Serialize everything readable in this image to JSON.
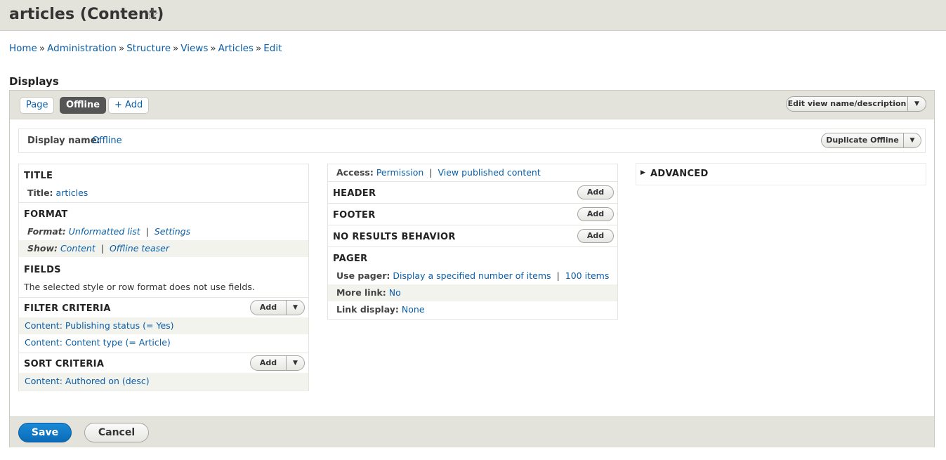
{
  "header": {
    "title": "articles (Content)",
    "star_icon": "☆"
  },
  "breadcrumb": {
    "items": [
      "Home",
      "Administration",
      "Structure",
      "Views",
      "Articles",
      "Edit"
    ],
    "separator": "»"
  },
  "displays": {
    "heading": "Displays",
    "tabs": [
      {
        "label": "Page"
      },
      {
        "label": "Offline"
      }
    ],
    "add_label": "+ Add",
    "edit_view_label": "Edit view name/description",
    "display_name_label": "Display name:",
    "display_name_value": "Offline",
    "duplicate_label": "Duplicate Offline"
  },
  "left": {
    "title_section": {
      "heading": "TITLE",
      "label": "Title:",
      "value": "articles"
    },
    "format_section": {
      "heading": "FORMAT",
      "format_label": "Format:",
      "format_value": "Unformatted list",
      "format_settings": "Settings",
      "show_label": "Show:",
      "show_value": "Content",
      "show_mode": "Offline teaser"
    },
    "fields_section": {
      "heading": "FIELDS",
      "note": "The selected style or row format does not use fields."
    },
    "filter_section": {
      "heading": "FILTER CRITERIA",
      "add_label": "Add",
      "items": [
        "Content: Publishing status (= Yes)",
        "Content: Content type (= Article)"
      ]
    },
    "sort_section": {
      "heading": "SORT CRITERIA",
      "add_label": "Add",
      "items": [
        "Content: Authored on (desc)"
      ]
    }
  },
  "middle": {
    "access": {
      "label": "Access:",
      "value": "Permission",
      "detail": "View published content"
    },
    "header": {
      "heading": "HEADER",
      "add_label": "Add"
    },
    "footer": {
      "heading": "FOOTER",
      "add_label": "Add"
    },
    "no_results": {
      "heading": "NO RESULTS BEHAVIOR",
      "add_label": "Add"
    },
    "pager": {
      "heading": "PAGER",
      "use_pager_label": "Use pager:",
      "use_pager_value": "Display a specified number of items",
      "use_pager_items": "100 items",
      "more_link_label": "More link:",
      "more_link_value": "No",
      "link_display_label": "Link display:",
      "link_display_value": "None"
    }
  },
  "right": {
    "advanced_label": "ADVANCED"
  },
  "footer_bar": {
    "save_label": "Save",
    "cancel_label": "Cancel"
  },
  "colors": {
    "link": "#0b5ea7",
    "bar": "#e3e3dc",
    "save": "#0b6bb8"
  }
}
